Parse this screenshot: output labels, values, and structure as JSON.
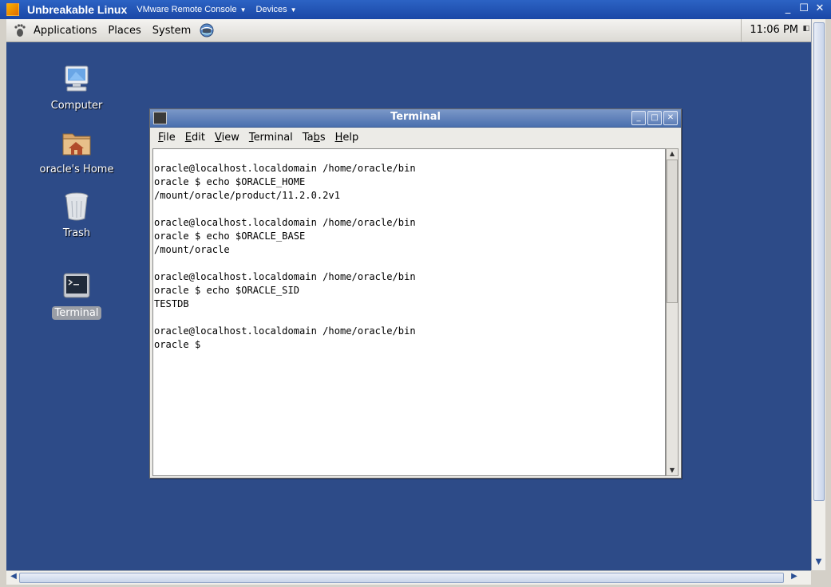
{
  "vmware": {
    "title": "Unbreakable Linux",
    "menus": [
      {
        "label": "VMware Remote Console"
      },
      {
        "label": "Devices"
      }
    ]
  },
  "panel": {
    "menus": [
      "Applications",
      "Places",
      "System"
    ],
    "clock": "11:06 PM"
  },
  "desktop_icons": [
    {
      "label": "Computer"
    },
    {
      "label": "oracle's Home"
    },
    {
      "label": "Trash"
    },
    {
      "label": "Terminal"
    }
  ],
  "terminal": {
    "title": "Terminal",
    "menu": [
      {
        "pre": "",
        "key": "F",
        "post": "ile"
      },
      {
        "pre": "",
        "key": "E",
        "post": "dit"
      },
      {
        "pre": "",
        "key": "V",
        "post": "iew"
      },
      {
        "pre": "",
        "key": "T",
        "post": "erminal"
      },
      {
        "pre": "Ta",
        "key": "b",
        "post": "s"
      },
      {
        "pre": "",
        "key": "H",
        "post": "elp"
      }
    ],
    "output": "oracle@localhost.localdomain /home/oracle/bin\noracle $ echo $ORACLE_HOME\n/mount/oracle/product/11.2.0.2v1\n\noracle@localhost.localdomain /home/oracle/bin\noracle $ echo $ORACLE_BASE\n/mount/oracle\n\noracle@localhost.localdomain /home/oracle/bin\noracle $ echo $ORACLE_SID\nTESTDB\n\noracle@localhost.localdomain /home/oracle/bin\noracle $ "
  }
}
